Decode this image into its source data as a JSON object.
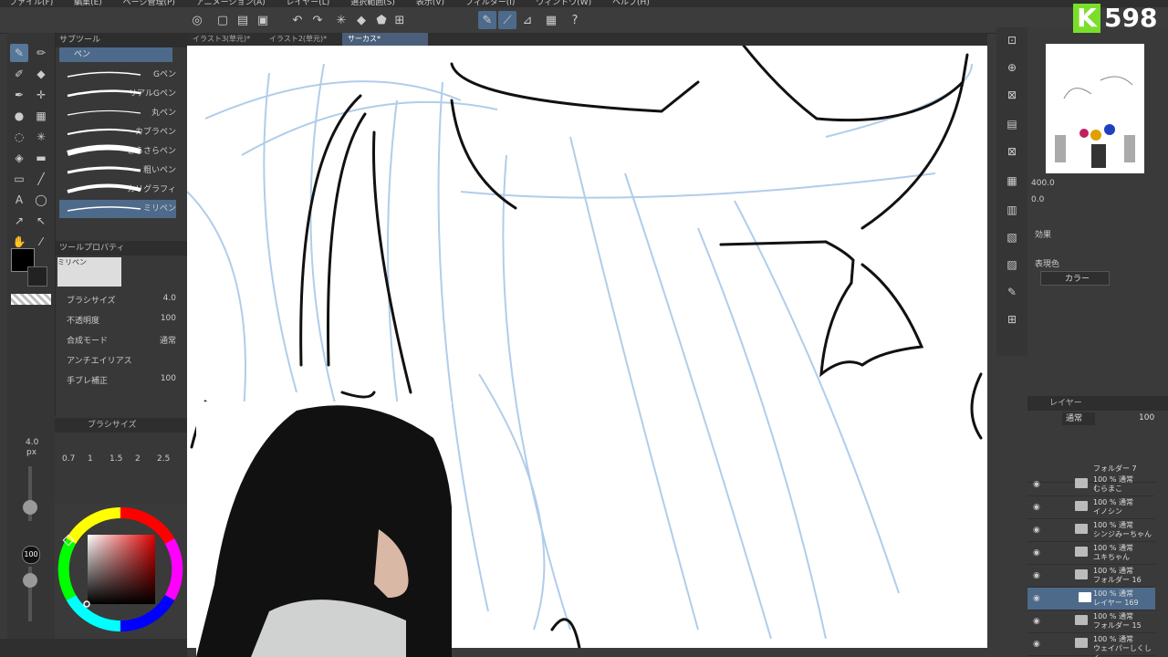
{
  "menu": [
    "ファイル(F)",
    "編集(E)",
    "ページ管理(P)",
    "アニメーション(A)",
    "レイヤー(L)",
    "選択範囲(S)",
    "表示(V)",
    "フィルター(I)",
    "ウィンドウ(W)",
    "ヘルプ(H)"
  ],
  "tabs": [
    {
      "label": "イラスト3(草元)*"
    },
    {
      "label": "イラスト2(草元)*"
    },
    {
      "label": "サーカス*"
    }
  ],
  "subtool": {
    "header": "サブツール",
    "group": "ペン",
    "brushes": [
      "Gペン",
      "リアルGペン",
      "丸ペン",
      "カブラペン",
      "さらさらペン",
      "粗いペン",
      "カリグラフィ",
      "ミリペン"
    ],
    "selected_index": 7
  },
  "toolprop": {
    "header": "ツールプロパティ",
    "preview_label": "ミリペン",
    "rows": [
      {
        "label": "ブラシサイズ",
        "value": "4.0"
      },
      {
        "label": "不透明度",
        "value": "100"
      },
      {
        "label": "合成モード",
        "value": "通常"
      },
      {
        "label": "アンチエイリアス",
        "value": ""
      },
      {
        "label": "手ブレ補正",
        "value": "100"
      }
    ]
  },
  "brushsize": {
    "header": "ブラシサイズ",
    "sizes": [
      "0.7",
      "1",
      "1.5",
      "2",
      "2.5"
    ],
    "current": "4.0",
    "unit": "px",
    "opacity": "100"
  },
  "navigator": {
    "zoom": "400.0",
    "angle": "0.0"
  },
  "effect": {
    "label": "効果",
    "color_label": "表現色",
    "color_value": "カラー"
  },
  "layers": {
    "header": "レイヤー",
    "blend": "通常",
    "opacity": "100",
    "items": [
      {
        "line1": "",
        "line2": "フォルダー 7",
        "selected": false
      },
      {
        "line1": "100 % 通常",
        "line2": "むらまこ",
        "selected": false
      },
      {
        "line1": "100 % 通常",
        "line2": "イノシン",
        "selected": false
      },
      {
        "line1": "100 % 通常",
        "line2": "シンジみーちゃん",
        "selected": false
      },
      {
        "line1": "100 % 通常",
        "line2": "ユキちゃん",
        "selected": false
      },
      {
        "line1": "100 % 通常",
        "line2": "フォルダー 16",
        "selected": false
      },
      {
        "line1": "100 % 通常",
        "line2": "レイヤー 169",
        "selected": true
      },
      {
        "line1": "100 % 通常",
        "line2": "フォルダー 15",
        "selected": false
      },
      {
        "line1": "100 % 通常",
        "line2": "ウェイパーしくしく",
        "selected": false
      }
    ]
  },
  "badge": {
    "letter": "K",
    "count": "598"
  },
  "colors": {
    "accent": "#4d6a8a",
    "sketch": "#a8c8e8",
    "panel": "#3a3a3a"
  }
}
